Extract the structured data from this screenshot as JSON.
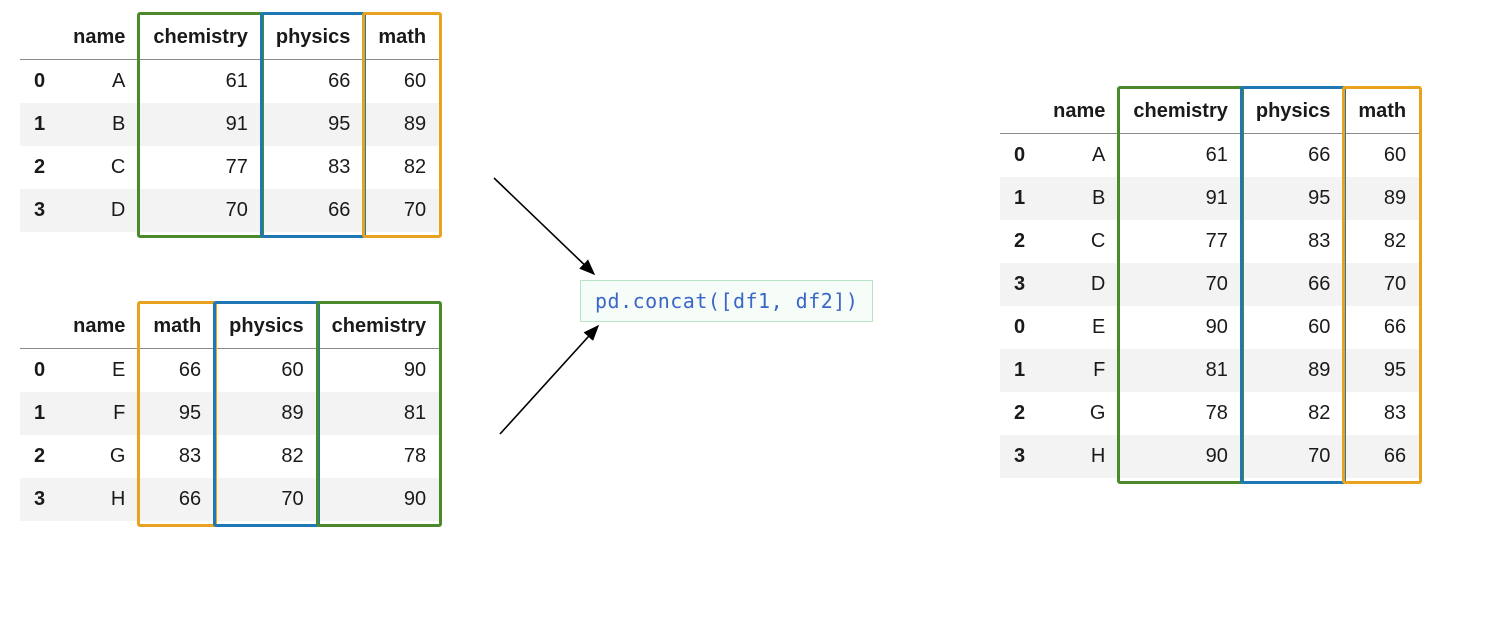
{
  "code_snippet": "pd.concat([df1, df2])",
  "df1": {
    "columns": [
      "name",
      "chemistry",
      "physics",
      "math"
    ],
    "index": [
      "0",
      "1",
      "2",
      "3"
    ],
    "rows": [
      [
        "A",
        "61",
        "66",
        "60"
      ],
      [
        "B",
        "91",
        "95",
        "89"
      ],
      [
        "C",
        "77",
        "83",
        "82"
      ],
      [
        "D",
        "70",
        "66",
        "70"
      ]
    ],
    "highlights": {
      "chemistry": "green",
      "physics": "blue",
      "math": "orange"
    }
  },
  "df2": {
    "columns": [
      "name",
      "math",
      "physics",
      "chemistry"
    ],
    "index": [
      "0",
      "1",
      "2",
      "3"
    ],
    "rows": [
      [
        "E",
        "66",
        "60",
        "90"
      ],
      [
        "F",
        "95",
        "89",
        "81"
      ],
      [
        "G",
        "83",
        "82",
        "78"
      ],
      [
        "H",
        "66",
        "70",
        "90"
      ]
    ],
    "highlights": {
      "math": "orange",
      "physics": "blue",
      "chemistry": "green"
    }
  },
  "df3": {
    "columns": [
      "name",
      "chemistry",
      "physics",
      "math"
    ],
    "index": [
      "0",
      "1",
      "2",
      "3",
      "0",
      "1",
      "2",
      "3"
    ],
    "rows": [
      [
        "A",
        "61",
        "66",
        "60"
      ],
      [
        "B",
        "91",
        "95",
        "89"
      ],
      [
        "C",
        "77",
        "83",
        "82"
      ],
      [
        "D",
        "70",
        "66",
        "70"
      ],
      [
        "E",
        "90",
        "60",
        "66"
      ],
      [
        "F",
        "81",
        "89",
        "95"
      ],
      [
        "G",
        "78",
        "82",
        "83"
      ],
      [
        "H",
        "90",
        "70",
        "66"
      ]
    ],
    "highlights": {
      "chemistry": "green",
      "physics": "blue",
      "math": "orange"
    }
  },
  "chart_data": {
    "type": "table",
    "description": "Illustration of pd.concat([df1, df2]) stacking two DataFrames vertically, aligning columns by name even when input column order differs.",
    "inputs": {
      "df1": {
        "columns": [
          "name",
          "chemistry",
          "physics",
          "math"
        ],
        "index": [
          0,
          1,
          2,
          3
        ],
        "data": [
          [
            "A",
            61,
            66,
            60
          ],
          [
            "B",
            91,
            95,
            89
          ],
          [
            "C",
            77,
            83,
            82
          ],
          [
            "D",
            70,
            66,
            70
          ]
        ]
      },
      "df2": {
        "columns": [
          "name",
          "math",
          "physics",
          "chemistry"
        ],
        "index": [
          0,
          1,
          2,
          3
        ],
        "data": [
          [
            "E",
            66,
            60,
            90
          ],
          [
            "F",
            95,
            89,
            81
          ],
          [
            "G",
            83,
            82,
            78
          ],
          [
            "H",
            66,
            70,
            90
          ]
        ]
      }
    },
    "operation": "pd.concat([df1, df2])",
    "output": {
      "columns": [
        "name",
        "chemistry",
        "physics",
        "math"
      ],
      "index": [
        0,
        1,
        2,
        3,
        0,
        1,
        2,
        3
      ],
      "data": [
        [
          "A",
          61,
          66,
          60
        ],
        [
          "B",
          91,
          95,
          89
        ],
        [
          "C",
          77,
          83,
          82
        ],
        [
          "D",
          70,
          66,
          70
        ],
        [
          "E",
          90,
          60,
          66
        ],
        [
          "F",
          81,
          89,
          95
        ],
        [
          "G",
          78,
          82,
          83
        ],
        [
          "H",
          90,
          70,
          66
        ]
      ]
    },
    "column_color_map": {
      "chemistry": "green",
      "physics": "blue",
      "math": "orange"
    }
  }
}
